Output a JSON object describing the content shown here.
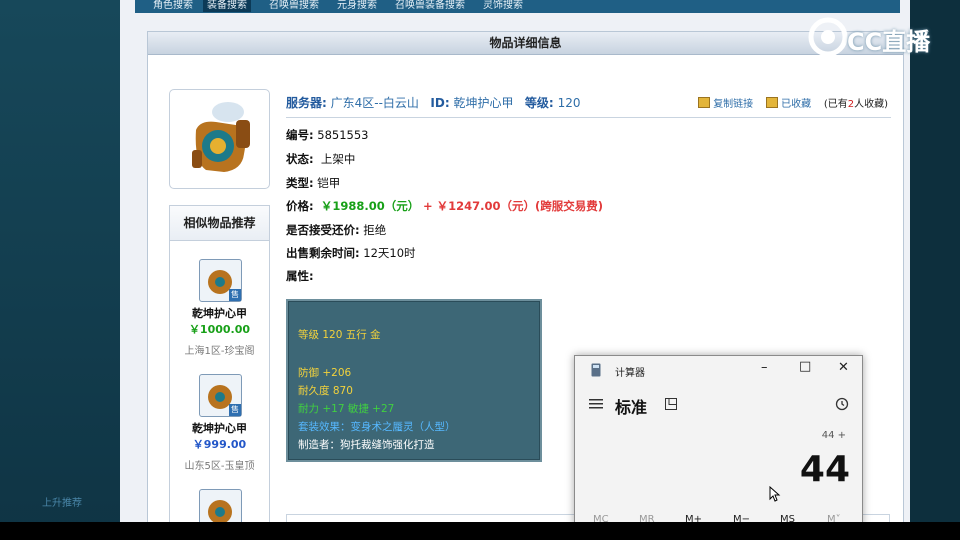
{
  "nav": {
    "items": [
      "角色搜索",
      "装备搜索",
      "召唤兽搜索",
      "元身搜索",
      "召唤兽装备搜索",
      "灵饰搜索"
    ],
    "active_index": 1
  },
  "left_faint_text": "上升推荐",
  "panel": {
    "title": "物品详细信息",
    "info": {
      "server_label": "服务器:",
      "server_value": "广东4区--白云山",
      "id_label": "ID:",
      "id_value": "乾坤护心甲",
      "level_label": "等级:",
      "level_value": "120",
      "copy_link": "复制链接",
      "favorited": "已收藏",
      "fav_prefix": "(已有",
      "fav_count": "2",
      "fav_suffix": "人收藏)"
    },
    "fields": {
      "code_label": "编号:",
      "code_value": "5851553",
      "status_label": "状态:",
      "status_value": "上架中",
      "type_label": "类型:",
      "type_value": "铠甲",
      "price_label": "价格:",
      "price_value": "￥1988.00（元）",
      "price_extra": "+ ￥1247.00（元）(跨服交易费)",
      "bargain_label": "是否接受还价:",
      "bargain_value": "拒绝",
      "remaining_label": "出售剩余时间:",
      "remaining_value": "12天10时",
      "attr_label": "属性:"
    },
    "stats": [
      {
        "text": "等级 120 五行 金",
        "color": "#f2d23c"
      },
      {
        "text": "防御 +206",
        "color": "#f2d23c"
      },
      {
        "text": "耐久度 870",
        "color": "#f2d23c"
      },
      {
        "text": "耐力 +17 敏捷 +27",
        "color": "#40d040"
      },
      {
        "text": "套装效果：变身术之蜃灵（人型）",
        "color": "#56b8ff"
      },
      {
        "text": "制造者：狗托裁缝饰强化打造",
        "color": "#ffffff"
      }
    ],
    "similar": {
      "title": "相似物品推荐",
      "badge": "售",
      "items": [
        {
          "name": "乾坤护心甲",
          "price": "￥1000.00",
          "price_color": "#18a018",
          "server": "上海1区-珍宝阁"
        },
        {
          "name": "乾坤护心甲",
          "price": "￥999.00",
          "price_color": "#2256c8",
          "server": "山东5区-玉皇顶"
        }
      ]
    }
  },
  "calculator": {
    "title": "计算器",
    "mode": "标准",
    "expression": "44 +",
    "display": "44",
    "memory_buttons": [
      "MC",
      "MR",
      "M+",
      "M−",
      "MS",
      "M˅"
    ]
  },
  "watermark": "CC直播"
}
